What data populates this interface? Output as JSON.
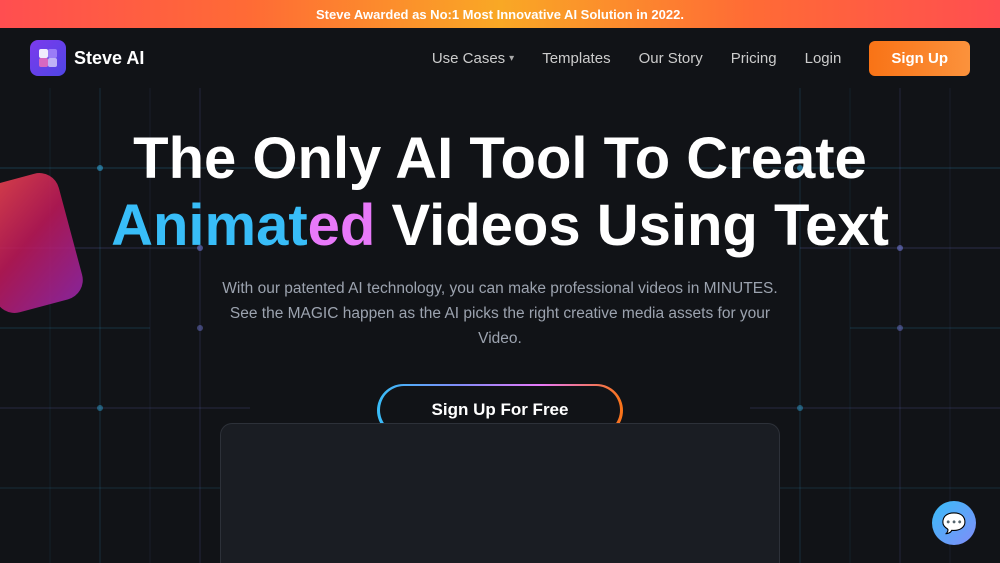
{
  "banner": {
    "text": "Steve Awarded as No:1 Most Innovative AI Solution in 2022."
  },
  "navbar": {
    "logo_text": "Steve AI",
    "use_cases_label": "Use Cases",
    "templates_label": "Templates",
    "our_story_label": "Our Story",
    "pricing_label": "Pricing",
    "login_label": "Login",
    "signup_label": "Sign Up"
  },
  "hero": {
    "title_line1": "The Only AI Tool To Create",
    "title_animated_blue": "Animat",
    "title_animated_pink": "ed",
    "title_line2": " Videos Using Text",
    "subtitle_line1": "With our patented AI technology, you can make professional videos in MINUTES.",
    "subtitle_line2": "See the MAGIC happen as the AI picks the right creative media assets for your Video.",
    "cta_label": "Sign Up For Free"
  },
  "chat": {
    "icon": "💬"
  }
}
